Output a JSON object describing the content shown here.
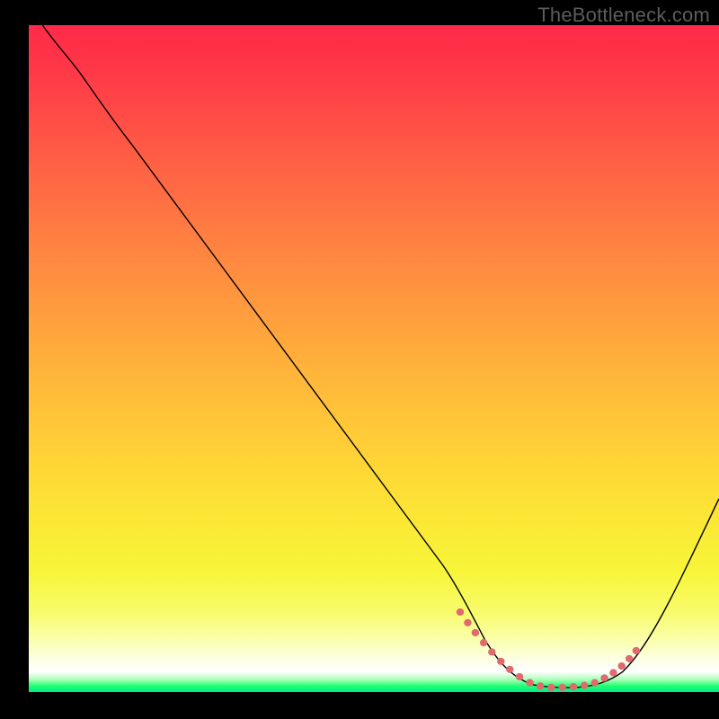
{
  "watermark": "TheBottleneck.com",
  "chart_data": {
    "type": "line",
    "title": "",
    "xlabel": "",
    "ylabel": "",
    "xlim": [
      0,
      100
    ],
    "ylim": [
      0,
      100
    ],
    "grid": false,
    "legend": false,
    "series": [
      {
        "name": "curve",
        "color": "#000000",
        "x": [
          2,
          6,
          10,
          15,
          20,
          25,
          30,
          35,
          40,
          45,
          50,
          55,
          60,
          63,
          66,
          70,
          74,
          78,
          82,
          86,
          90,
          94,
          97,
          100
        ],
        "y": [
          100,
          95,
          89,
          82,
          75,
          68,
          61,
          54,
          47,
          40,
          33,
          26,
          19,
          13,
          8,
          3.5,
          1.2,
          0.6,
          0.6,
          1.7,
          5,
          12,
          20,
          29
        ]
      },
      {
        "name": "dotted-valley",
        "color": "#e06a6e",
        "style": "dotted",
        "x": [
          62.5,
          64,
          65.5,
          67,
          69,
          71,
          73,
          75,
          77,
          79,
          81,
          83,
          85,
          86.5,
          88
        ],
        "y": [
          12,
          9.5,
          7.2,
          5.2,
          3.3,
          1.9,
          1.1,
          0.8,
          0.8,
          1.0,
          1.5,
          2.4,
          3.6,
          5.0,
          6.8
        ]
      }
    ],
    "gradient_note": "Background is a vertical red-to-green gradient representing bottleneck severity; curve overlays it."
  }
}
